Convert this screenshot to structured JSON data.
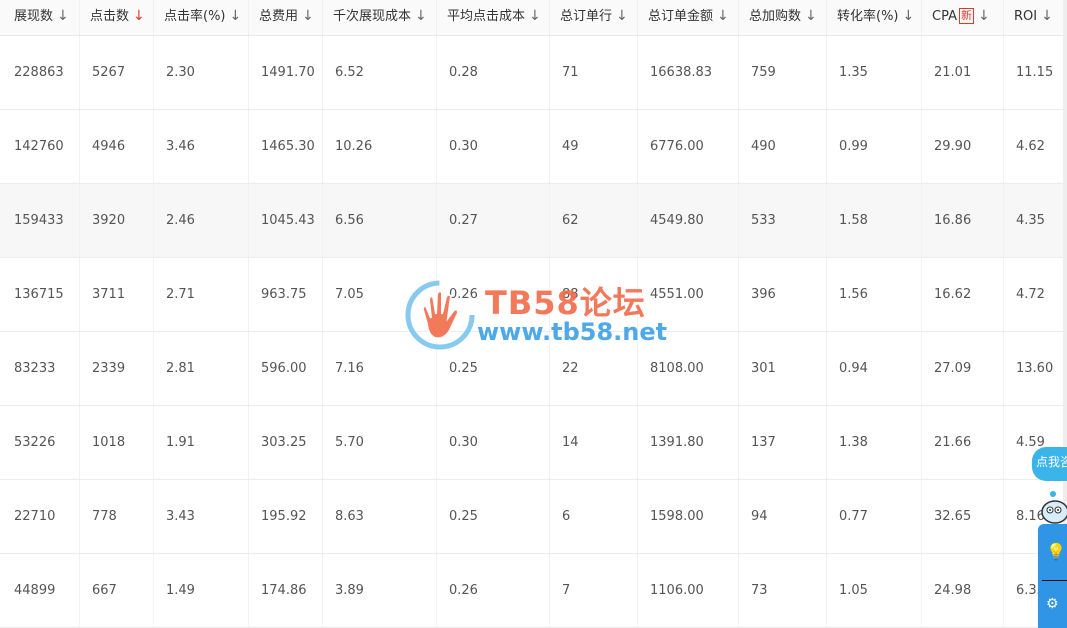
{
  "table": {
    "columns": [
      {
        "label": "展现数",
        "arrow": "↓",
        "arrow_color": "gray"
      },
      {
        "label": "点击数",
        "arrow": "↓",
        "arrow_color": "red"
      },
      {
        "label": "点击率(%)",
        "arrow": "↓",
        "arrow_color": "gray"
      },
      {
        "label": "总费用",
        "arrow": "↓",
        "arrow_color": "gray"
      },
      {
        "label": "千次展现成本",
        "arrow": "↓",
        "arrow_color": "gray"
      },
      {
        "label": "平均点击成本",
        "arrow": "↓",
        "arrow_color": "gray"
      },
      {
        "label": "总订单行",
        "arrow": "↓",
        "arrow_color": "gray"
      },
      {
        "label": "总订单金额",
        "arrow": "↓",
        "arrow_color": "gray"
      },
      {
        "label": "总加购数",
        "arrow": "↓",
        "arrow_color": "gray"
      },
      {
        "label": "转化率(%)",
        "arrow": "↓",
        "arrow_color": "gray"
      },
      {
        "label": "CPA",
        "badge": "新",
        "arrow": "↓",
        "arrow_color": "gray"
      },
      {
        "label": "ROI",
        "arrow": "↓",
        "arrow_color": "gray"
      }
    ],
    "rows": [
      [
        "228863",
        "5267",
        "2.30",
        "1491.70",
        "6.52",
        "0.28",
        "71",
        "16638.83",
        "759",
        "1.35",
        "21.01",
        "11.15"
      ],
      [
        "142760",
        "4946",
        "3.46",
        "1465.30",
        "10.26",
        "0.30",
        "49",
        "6776.00",
        "490",
        "0.99",
        "29.90",
        "4.62"
      ],
      [
        "159433",
        "3920",
        "2.46",
        "1045.43",
        "6.56",
        "0.27",
        "62",
        "4549.80",
        "533",
        "1.58",
        "16.86",
        "4.35"
      ],
      [
        "136715",
        "3711",
        "2.71",
        "963.75",
        "7.05",
        "0.26",
        "88",
        "4551.00",
        "396",
        "1.56",
        "16.62",
        "4.72"
      ],
      [
        "83233",
        "2339",
        "2.81",
        "596.00",
        "7.16",
        "0.25",
        "22",
        "8108.00",
        "301",
        "0.94",
        "27.09",
        "13.60"
      ],
      [
        "53226",
        "1018",
        "1.91",
        "303.25",
        "5.70",
        "0.30",
        "14",
        "1391.80",
        "137",
        "1.38",
        "21.66",
        "4.59"
      ],
      [
        "22710",
        "778",
        "3.43",
        "195.92",
        "8.63",
        "0.25",
        "6",
        "1598.00",
        "94",
        "0.77",
        "32.65",
        "8.16"
      ],
      [
        "44899",
        "667",
        "1.49",
        "174.86",
        "3.89",
        "0.26",
        "7",
        "1106.00",
        "73",
        "1.05",
        "24.98",
        "6.33"
      ]
    ]
  },
  "watermark": {
    "title": "TB58论坛",
    "url": "www.tb58.net"
  },
  "help_widget": {
    "bubble_text": "点我咨询"
  },
  "colors": {
    "accent_red": "#e0392b",
    "watermark_orange": "#f26b4a",
    "watermark_blue": "#3aa0e8",
    "widget_blue": "#2f95e4"
  }
}
